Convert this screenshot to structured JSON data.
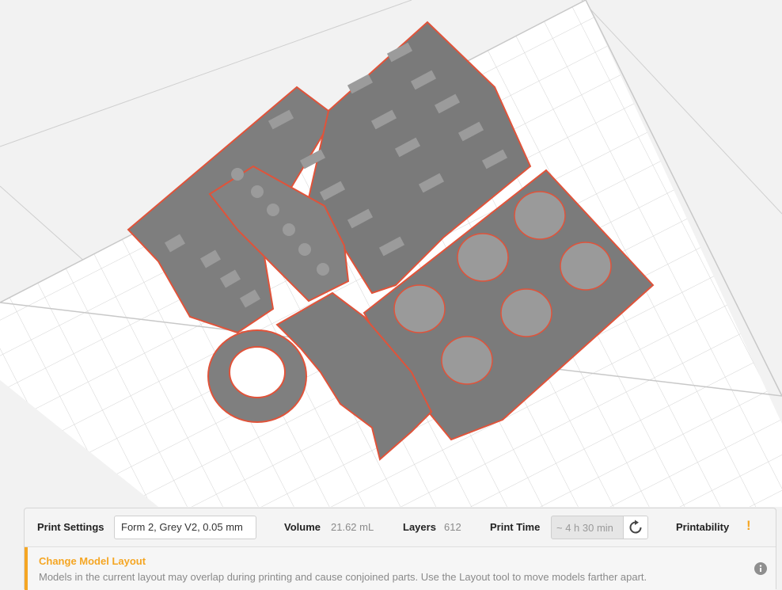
{
  "settings_bar": {
    "print_settings_label": "Print Settings",
    "print_settings_value": "Form 2, Grey V2, 0.05 mm",
    "volume_label": "Volume",
    "volume_value": "21.62 mL",
    "layers_label": "Layers",
    "layers_value": "612",
    "print_time_label": "Print Time",
    "print_time_value": "~ 4 h 30 min",
    "printability_label": "Printability",
    "printability_status": "!"
  },
  "alert": {
    "title": "Change Model Layout",
    "message": "Models in the current layout may overlap during printing and cause conjoined parts. Use the Layout tool to move models farther apart."
  },
  "icons": {
    "refresh": "refresh-icon",
    "info": "info-icon",
    "warning": "warning-icon"
  },
  "colors": {
    "accent_warning": "#f5a623",
    "model_grey": "#7c7c7c",
    "support_outline": "#e0533a",
    "build_plate": "#ffffff",
    "grid_line": "#d4d4d4"
  }
}
